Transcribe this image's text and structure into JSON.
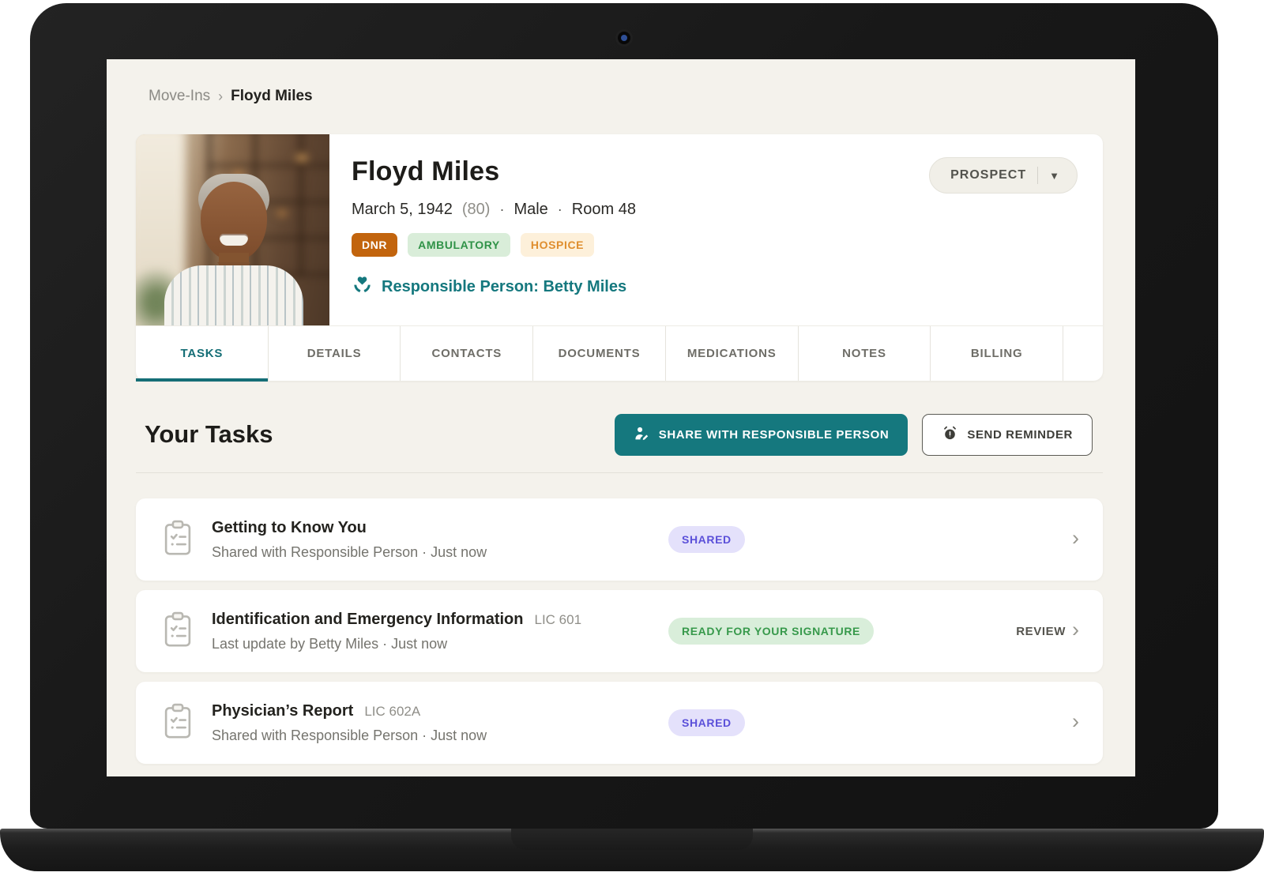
{
  "breadcrumb": {
    "parent": "Move-Ins",
    "separator": "›",
    "current": "Floyd Miles"
  },
  "profile": {
    "name": "Floyd Miles",
    "birth_date": "March 5, 1942",
    "age": "(80)",
    "separator": "·",
    "gender": "Male",
    "room": "Room 48",
    "badges": [
      {
        "label": "DNR",
        "type": "dnr"
      },
      {
        "label": "AMBULATORY",
        "type": "ambulatory"
      },
      {
        "label": "HOSPICE",
        "type": "hospice"
      }
    ],
    "responsible_person": "Responsible Person: Betty Miles",
    "status_button": {
      "label": "PROSPECT",
      "caret": "▼"
    }
  },
  "tabs": [
    {
      "label": "TASKS",
      "active": true
    },
    {
      "label": "DETAILS",
      "active": false
    },
    {
      "label": "CONTACTS",
      "active": false
    },
    {
      "label": "DOCUMENTS",
      "active": false
    },
    {
      "label": "MEDICATIONS",
      "active": false
    },
    {
      "label": "NOTES",
      "active": false
    },
    {
      "label": "BILLING",
      "active": false
    }
  ],
  "tasks_section": {
    "title": "Your Tasks",
    "share_button": "SHARE WITH RESPONSIBLE PERSON",
    "reminder_button": "SEND REMINDER",
    "items": [
      {
        "title": "Getting to Know You",
        "code": "",
        "subtitle": "Shared with Responsible Person · Just now",
        "status": "SHARED",
        "status_type": "shared",
        "action": "",
        "chevron": "›"
      },
      {
        "title": "Identification and Emergency Information",
        "code": "LIC 601",
        "subtitle": "Last update by Betty Miles · Just now",
        "status": "READY FOR YOUR SIGNATURE",
        "status_type": "ready",
        "action": "REVIEW",
        "chevron": "›"
      },
      {
        "title": "Physician’s Report",
        "code": "LIC 602A",
        "subtitle": "Shared with Responsible Person · Just now",
        "status": "SHARED",
        "status_type": "shared",
        "action": "",
        "chevron": "›"
      }
    ]
  },
  "colors": {
    "accent_teal": "#15787e",
    "dnr_badge": "#c2640d",
    "ambulatory_text": "#2f9247",
    "hospice_text": "#df8e2e",
    "shared_badge_text": "#5b50d9",
    "ready_badge_text": "#37994b",
    "screen_background": "#f4f2ec"
  }
}
